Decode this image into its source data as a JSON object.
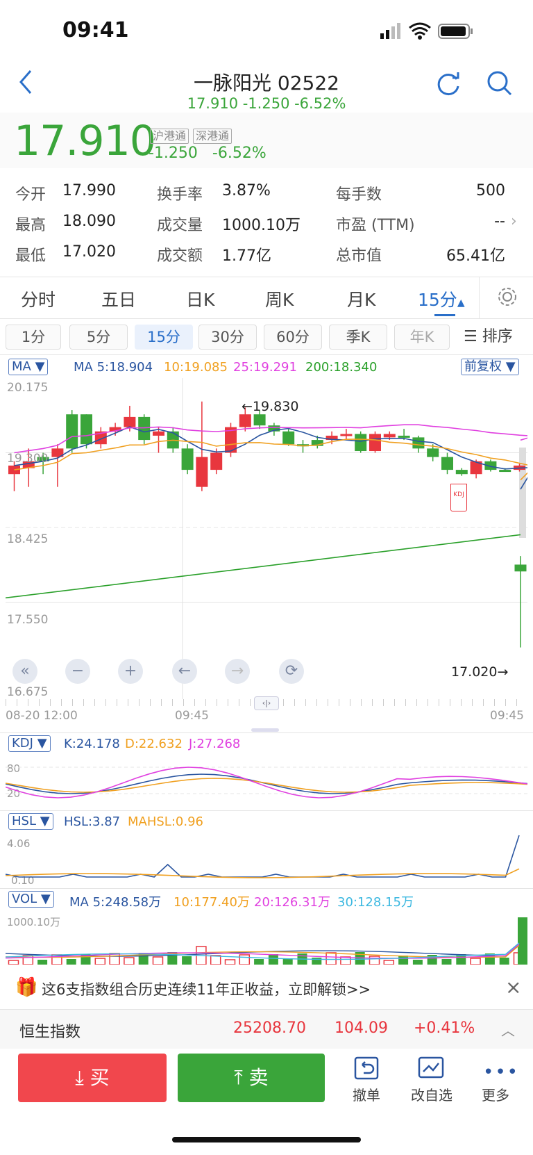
{
  "status": {
    "time": "09:41"
  },
  "header": {
    "title": "一脉阳光 02522",
    "subtitle": "17.910 -1.250 -6.52%"
  },
  "quote": {
    "price": "17.910",
    "tags": [
      "沪港通",
      "深港通"
    ],
    "change": "-1.250",
    "change_pct": "-6.52%"
  },
  "stats": [
    [
      {
        "label": "今开",
        "value": "17.990"
      },
      {
        "label": "换手率",
        "value": "3.87%"
      },
      {
        "label": "每手数",
        "value": "500"
      }
    ],
    [
      {
        "label": "最高",
        "value": "18.090"
      },
      {
        "label": "成交量",
        "value": "1000.10万"
      },
      {
        "label": "市盈 (TTM)",
        "value": "--"
      }
    ],
    [
      {
        "label": "最低",
        "value": "17.020"
      },
      {
        "label": "成交额",
        "value": "1.77亿"
      },
      {
        "label": "总市值",
        "value": "65.41亿"
      }
    ]
  ],
  "period_tabs": [
    "分时",
    "五日",
    "日K",
    "周K",
    "月K",
    "15分"
  ],
  "interval_chips": [
    "1分",
    "5分",
    "15分",
    "30分",
    "60分",
    "季K",
    "年K"
  ],
  "sort_label": "排序",
  "ma": {
    "selector": "MA",
    "ma5": "MA 5:18.904",
    "ma10": "10:19.085",
    "ma25": "25:19.291",
    "ma200": "200:18.340",
    "adjust": "前复权"
  },
  "colors": {
    "ma5": "#2a55a0",
    "ma10": "#f0a020",
    "ma25": "#e040e0",
    "ma200": "#2aa02a",
    "up": "#e8363e",
    "down": "#3aa53a"
  },
  "price_axis": [
    "20.175",
    "19.300",
    "18.425",
    "17.550",
    "16.675"
  ],
  "annotations": {
    "high": "←19.830",
    "low": "17.020→"
  },
  "kdj_marker": "KDJ",
  "time_axis": [
    "08-20 12:00",
    "09:45",
    "09:45"
  ],
  "kdj": {
    "selector": "KDJ",
    "k": "K:24.178",
    "d": "D:22.632",
    "j": "J:27.268",
    "axis": [
      "80",
      "20"
    ]
  },
  "hsl": {
    "selector": "HSL",
    "hsl": "HSL:3.87",
    "mahsl": "MAHSL:0.96",
    "axis": [
      "4.06",
      "0.10"
    ]
  },
  "vol": {
    "selector": "VOL",
    "ma5": "MA 5:248.58万",
    "ma10": "10:177.40万",
    "ma20": "20:126.31万",
    "ma30": "30:128.15万",
    "axis": "1000.10万"
  },
  "promo": {
    "text": "这6支指数组合历史连续11年正收益，立即解锁>>"
  },
  "index_bar": {
    "name": "恒生指数",
    "value": "25208.70",
    "change": "104.09",
    "pct": "+0.41%"
  },
  "actions": {
    "buy": "买",
    "sell": "卖",
    "cancel": "撤单",
    "watchlist": "改自选",
    "more": "更多"
  },
  "chart_data": {
    "type": "candlestick",
    "ylim": [
      16.675,
      20.175
    ],
    "candles": [
      {
        "o": 19.05,
        "c": 19.15,
        "h": 19.2,
        "l": 18.85,
        "up": true
      },
      {
        "o": 19.12,
        "c": 19.2,
        "h": 19.35,
        "l": 18.9,
        "up": true
      },
      {
        "o": 19.2,
        "c": 19.25,
        "h": 19.3,
        "l": 19.05,
        "up": false
      },
      {
        "o": 19.25,
        "c": 19.35,
        "h": 19.4,
        "l": 18.9,
        "up": true
      },
      {
        "o": 19.35,
        "c": 19.75,
        "h": 19.8,
        "l": 19.3,
        "up": false
      },
      {
        "o": 19.75,
        "c": 19.4,
        "h": 19.75,
        "l": 19.35,
        "up": false
      },
      {
        "o": 19.4,
        "c": 19.55,
        "h": 19.6,
        "l": 19.35,
        "up": true
      },
      {
        "o": 19.55,
        "c": 19.6,
        "h": 19.65,
        "l": 19.5,
        "up": true
      },
      {
        "o": 19.6,
        "c": 19.72,
        "h": 19.85,
        "l": 19.55,
        "up": true
      },
      {
        "o": 19.72,
        "c": 19.45,
        "h": 19.75,
        "l": 19.4,
        "up": false
      },
      {
        "o": 19.5,
        "c": 19.55,
        "h": 19.6,
        "l": 19.3,
        "up": true
      },
      {
        "o": 19.55,
        "c": 19.35,
        "h": 19.6,
        "l": 19.3,
        "up": false
      },
      {
        "o": 19.35,
        "c": 19.1,
        "h": 19.4,
        "l": 19.05,
        "up": false
      },
      {
        "o": 18.9,
        "c": 19.25,
        "h": 19.9,
        "l": 18.85,
        "up": true
      },
      {
        "o": 19.1,
        "c": 19.3,
        "h": 19.35,
        "l": 19.05,
        "up": true
      },
      {
        "o": 19.3,
        "c": 19.6,
        "h": 19.65,
        "l": 19.25,
        "up": true
      },
      {
        "o": 19.6,
        "c": 19.75,
        "h": 19.83,
        "l": 19.55,
        "up": true
      },
      {
        "o": 19.75,
        "c": 19.62,
        "h": 19.8,
        "l": 19.58,
        "up": false
      },
      {
        "o": 19.62,
        "c": 19.55,
        "h": 19.65,
        "l": 19.5,
        "up": false
      },
      {
        "o": 19.55,
        "c": 19.4,
        "h": 19.58,
        "l": 19.38,
        "up": false
      },
      {
        "o": 19.4,
        "c": 19.38,
        "h": 19.45,
        "l": 19.3,
        "up": false
      },
      {
        "o": 19.38,
        "c": 19.45,
        "h": 19.5,
        "l": 19.35,
        "up": false
      },
      {
        "o": 19.45,
        "c": 19.5,
        "h": 19.55,
        "l": 19.4,
        "up": true
      },
      {
        "o": 19.5,
        "c": 19.52,
        "h": 19.58,
        "l": 19.45,
        "up": true
      },
      {
        "o": 19.52,
        "c": 19.32,
        "h": 19.55,
        "l": 19.3,
        "up": false
      },
      {
        "o": 19.32,
        "c": 19.52,
        "h": 19.55,
        "l": 19.3,
        "up": true
      },
      {
        "o": 19.52,
        "c": 19.48,
        "h": 19.55,
        "l": 19.45,
        "up": true
      },
      {
        "o": 19.48,
        "c": 19.5,
        "h": 19.58,
        "l": 19.45,
        "up": false
      },
      {
        "o": 19.48,
        "c": 19.35,
        "h": 19.5,
        "l": 19.3,
        "up": false
      },
      {
        "o": 19.35,
        "c": 19.25,
        "h": 19.4,
        "l": 19.2,
        "up": false
      },
      {
        "o": 19.25,
        "c": 19.1,
        "h": 19.3,
        "l": 19.05,
        "up": false
      },
      {
        "o": 19.1,
        "c": 19.05,
        "h": 19.12,
        "l": 19.03,
        "up": false
      },
      {
        "o": 19.05,
        "c": 19.2,
        "h": 19.22,
        "l": 19.0,
        "up": true
      },
      {
        "o": 19.2,
        "c": 19.1,
        "h": 19.22,
        "l": 19.08,
        "up": false
      },
      {
        "o": 19.1,
        "c": 19.1,
        "h": 19.12,
        "l": 19.08,
        "up": false
      },
      {
        "o": 19.1,
        "c": 19.15,
        "h": 19.17,
        "l": 19.08,
        "up": true
      },
      {
        "o": 19.15,
        "c": 19.1,
        "h": 19.16,
        "l": 19.08,
        "up": true
      },
      {
        "o": 17.99,
        "c": 17.91,
        "h": 18.09,
        "l": 17.02,
        "up": false
      }
    ],
    "ma200_start": 17.6,
    "ma200_end": 18.34
  }
}
